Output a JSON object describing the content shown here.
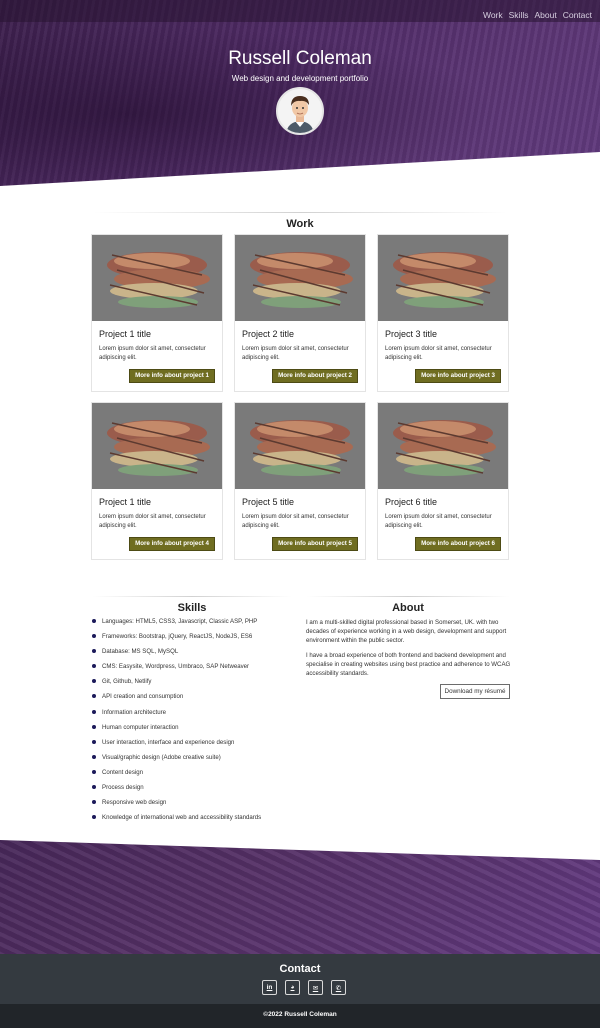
{
  "nav": {
    "items": [
      {
        "label": "Work"
      },
      {
        "label": "Skills"
      },
      {
        "label": "About"
      },
      {
        "label": "Contact"
      }
    ]
  },
  "hero": {
    "title": "Russell Coleman",
    "subtitle": "Web design and development portfolio"
  },
  "work": {
    "heading": "Work",
    "cards": [
      {
        "title": "Project 1 title",
        "text": "Lorem ipsum dolor sit amet, consectetur adipiscing elit.",
        "button": "More info about project 1"
      },
      {
        "title": "Project 2 title",
        "text": "Lorem ipsum dolor sit amet, consectetur adipiscing elit.",
        "button": "More info about project 2"
      },
      {
        "title": "Project 3 title",
        "text": "Lorem ipsum dolor sit amet, consectetur adipiscing elit.",
        "button": "More info about project 3"
      },
      {
        "title": "Project 1 title",
        "text": "Lorem ipsum dolor sit amet, consectetur adipiscing elit.",
        "button": "More info about project 4"
      },
      {
        "title": "Project 5 title",
        "text": "Lorem ipsum dolor sit amet, consectetur adipiscing elit.",
        "button": "More info about project 5"
      },
      {
        "title": "Project 6 title",
        "text": "Lorem ipsum dolor sit amet, consectetur adipiscing elit.",
        "button": "More info about project 6"
      }
    ]
  },
  "skills": {
    "heading": "Skills",
    "items": [
      "Languages: HTML5, CSS3, Javascript, Classic ASP, PHP",
      "Frameworks: Bootstrap, jQuery, ReactJS, NodeJS, ES6",
      "Database: MS SQL, MySQL",
      "CMS: Easysite, Wordpress, Umbraco, SAP Netweaver",
      "Git, Github, Netlify",
      "API creation and consumption",
      "Information architecture",
      "Human computer interaction",
      "User interaction, interface and experience design",
      "Visual/graphic design (Adobe creative suite)",
      "Content design",
      "Process design",
      "Responsive web design",
      "Knowledge of international web and accessibility standards"
    ]
  },
  "about": {
    "heading": "About",
    "paragraphs": [
      "I am a multi-skilled digital professional based in Somerset, UK. with two decades of experience working in a web design, development and support environment within the public sector.",
      "I have a broad experience of both frontend and backend development and specialise in creating websites using best practice and adherence to WCAG accessibility standards."
    ],
    "resume_button": "Download my résumé"
  },
  "contact": {
    "heading": "Contact",
    "icons": [
      {
        "name": "linkedin-icon",
        "glyph": "in"
      },
      {
        "name": "github-icon",
        "glyph": "◕"
      },
      {
        "name": "email-icon",
        "glyph": "✉"
      },
      {
        "name": "phone-icon",
        "glyph": "✆"
      }
    ]
  },
  "footer": {
    "copyright": "©2022 Russell Coleman"
  },
  "colors": {
    "hero_purple": "#4e2a64",
    "button_olive": "#6f6d21",
    "contact_bg": "#343a40",
    "footer_bg": "#212529",
    "bullet": "#1c1a5a"
  }
}
